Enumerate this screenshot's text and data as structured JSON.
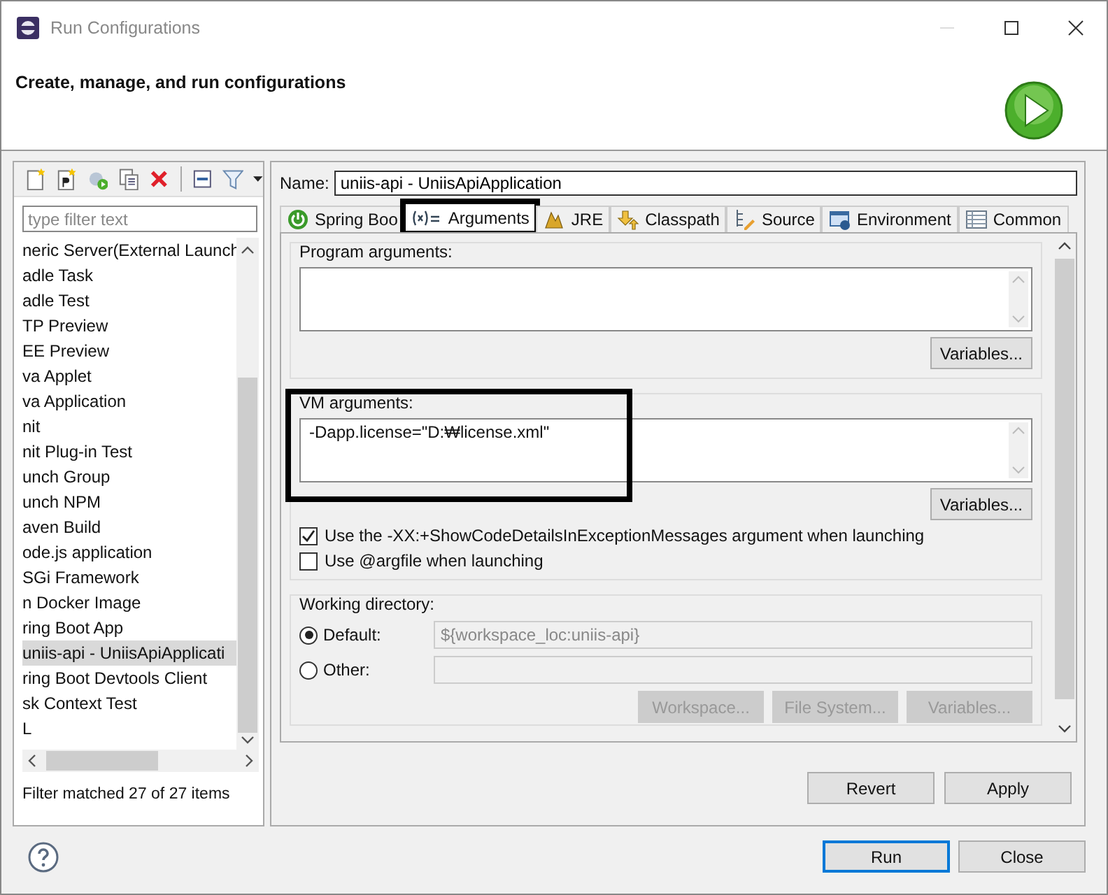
{
  "window": {
    "title": "Run Configurations"
  },
  "header": {
    "title": "Create, manage, and run configurations"
  },
  "sidebar": {
    "filter": {
      "placeholder": "type filter text"
    },
    "items": [
      {
        "label": "neric Server(External Launch",
        "selected": false
      },
      {
        "label": "adle Task",
        "selected": false
      },
      {
        "label": "adle Test",
        "selected": false
      },
      {
        "label": "TP Preview",
        "selected": false
      },
      {
        "label": "EE Preview",
        "selected": false
      },
      {
        "label": "va Applet",
        "selected": false
      },
      {
        "label": "va Application",
        "selected": false
      },
      {
        "label": "nit",
        "selected": false
      },
      {
        "label": "nit Plug-in Test",
        "selected": false
      },
      {
        "label": "unch Group",
        "selected": false
      },
      {
        "label": "unch NPM",
        "selected": false
      },
      {
        "label": "aven Build",
        "selected": false
      },
      {
        "label": "ode.js application",
        "selected": false
      },
      {
        "label": "SGi Framework",
        "selected": false
      },
      {
        "label": "n Docker Image",
        "selected": false
      },
      {
        "label": "ring Boot App",
        "selected": false
      },
      {
        "label": "uniis-api - UniisApiApplicati",
        "selected": true
      },
      {
        "label": "ring Boot Devtools Client",
        "selected": false
      },
      {
        "label": "sk Context Test",
        "selected": false
      },
      {
        "label": "L",
        "selected": false
      }
    ],
    "status": "Filter matched 27 of 27 items"
  },
  "config": {
    "name_label": "Name:",
    "name_value": "uniis-api - UniisApiApplication",
    "tabs": [
      {
        "label": "Spring Boo",
        "selected": false,
        "highlighted": false
      },
      {
        "label": "Arguments",
        "selected": true,
        "highlighted": true
      },
      {
        "label": "JRE",
        "selected": false,
        "highlighted": false
      },
      {
        "label": "Classpath",
        "selected": false,
        "highlighted": false
      },
      {
        "label": "Source",
        "selected": false,
        "highlighted": false
      },
      {
        "label": "Environment",
        "selected": false,
        "highlighted": false
      },
      {
        "label": "Common",
        "selected": false,
        "highlighted": false
      }
    ],
    "program_arguments": {
      "label": "Program arguments:",
      "button": "Variables...",
      "highlighted": false
    },
    "vm_arguments": {
      "label": "VM arguments:",
      "value": "-Dapp.license=\"D:₩license.xml\"",
      "button": "Variables...",
      "highlighted": true
    },
    "options": [
      {
        "label": "Use the -XX:+ShowCodeDetailsInExceptionMessages argument when launching",
        "checked": true
      },
      {
        "label": "Use @argfile when launching",
        "checked": false
      }
    ],
    "working_directory": {
      "label": "Working directory:",
      "choices": [
        {
          "label": "Default:",
          "selected": true,
          "value": "${workspace_loc:uniis-api}",
          "disabled": true
        },
        {
          "label": "Other:",
          "selected": false,
          "disabled": true
        }
      ],
      "buttons": [
        {
          "label": "Workspace...",
          "disabled": true
        },
        {
          "label": "File System...",
          "disabled": true
        },
        {
          "label": "Variables...",
          "disabled": true
        }
      ]
    },
    "buttons": [
      {
        "label": "Revert"
      },
      {
        "label": "Apply"
      }
    ]
  },
  "footer": {
    "buttons": [
      {
        "label": "Run",
        "default": true
      },
      {
        "label": "Close",
        "default": false
      }
    ]
  }
}
